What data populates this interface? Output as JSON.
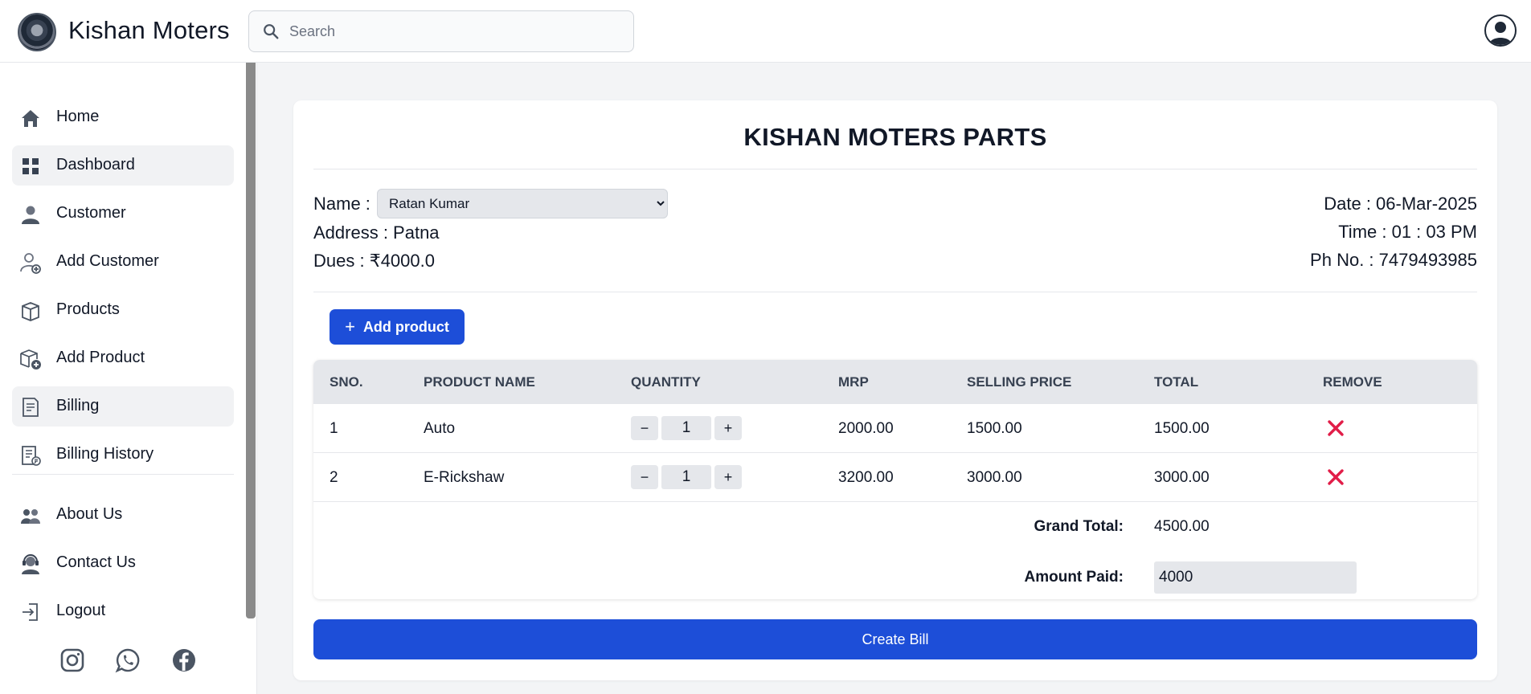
{
  "header": {
    "brand": "Kishan Moters",
    "search_placeholder": "Search"
  },
  "sidebar": {
    "items": [
      {
        "label": "Home",
        "icon": "home-icon"
      },
      {
        "label": "Dashboard",
        "icon": "dashboard-grid-icon",
        "active": true
      },
      {
        "label": "Customer",
        "icon": "customer-icon"
      },
      {
        "label": "Add Customer",
        "icon": "add-customer-icon"
      },
      {
        "label": "Products",
        "icon": "box-icon"
      },
      {
        "label": "Add Product",
        "icon": "add-product-icon"
      },
      {
        "label": "Billing",
        "icon": "invoice-icon",
        "active": true
      },
      {
        "label": "Billing History",
        "icon": "billing-history-icon"
      }
    ],
    "bottom_items": [
      {
        "label": "About Us",
        "icon": "users-icon"
      },
      {
        "label": "Contact Us",
        "icon": "headset-icon"
      },
      {
        "label": "Logout",
        "icon": "logout-icon"
      }
    ],
    "social": [
      "instagram-icon",
      "whatsapp-icon",
      "facebook-icon"
    ]
  },
  "bill": {
    "shop_title": "KISHAN MOTERS PARTS",
    "name_label": "Name :",
    "name_value": "Ratan Kumar",
    "address": "Address : Patna",
    "dues": "Dues : ₹4000.0",
    "date": "Date : 06-Mar-2025",
    "time": "Time : 01 : 03 PM",
    "phone": "Ph No. : 7479493985",
    "add_product_label": "Add product"
  },
  "table": {
    "headers": [
      "SNO.",
      "PRODUCT NAME",
      "QUANTITY",
      "MRP",
      "SELLING PRICE",
      "TOTAL",
      "REMOVE"
    ],
    "rows": [
      {
        "sno": "1",
        "name": "Auto",
        "qty": "1",
        "mrp": "2000.00",
        "selling": "1500.00",
        "total": "1500.00"
      },
      {
        "sno": "2",
        "name": "E-Rickshaw",
        "qty": "1",
        "mrp": "3200.00",
        "selling": "3000.00",
        "total": "3000.00"
      }
    ],
    "minus": "−",
    "plus": "+",
    "grand_total_label": "Grand Total:",
    "grand_total": "4500.00",
    "amount_paid_label": "Amount Paid:",
    "amount_paid": "4000"
  },
  "create_bill_label": "Create Bill",
  "colors": {
    "primary": "#1d4ed8",
    "remove": "#e11d48",
    "table_header": "#e5e7eb"
  }
}
